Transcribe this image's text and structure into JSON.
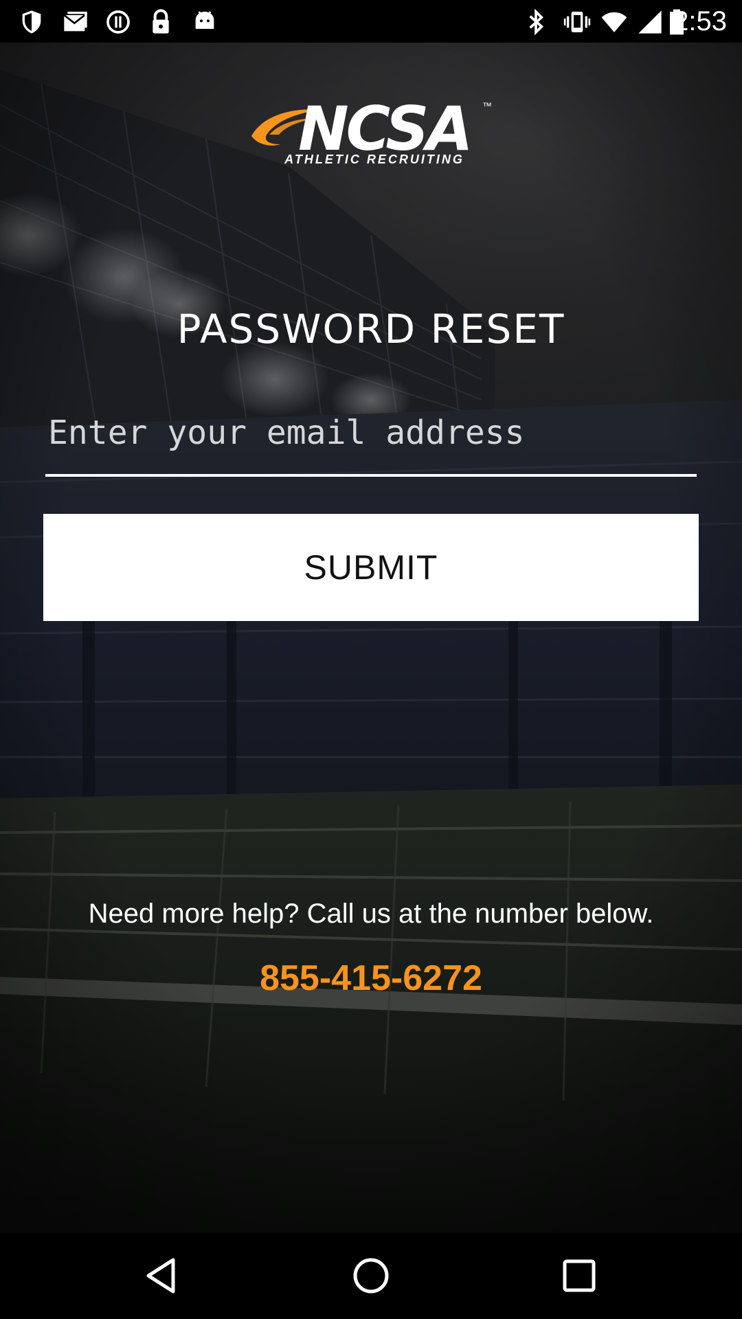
{
  "status_bar": {
    "time": "2:53",
    "left_icons": [
      "shield-icon",
      "mail-icon",
      "sync-icon",
      "lock-icon",
      "android-icon"
    ],
    "right_icons": [
      "bluetooth-icon",
      "vibrate-icon",
      "wifi-icon",
      "signal-icon",
      "battery-icon"
    ]
  },
  "logo": {
    "wordmark": "NCSA",
    "trademark": "™",
    "tagline": "ATHLETIC RECRUITING",
    "accent_color": "#f7941d"
  },
  "form": {
    "title": "PASSWORD RESET",
    "email_placeholder": "Enter your email address",
    "email_value": "",
    "submit_label": "SUBMIT"
  },
  "help": {
    "text": "Need more help? Call us at the number below.",
    "phone": "855-415-6272",
    "phone_color": "#f7941d"
  },
  "nav_bar": {
    "buttons": [
      "back-icon",
      "home-icon",
      "recents-icon"
    ]
  }
}
